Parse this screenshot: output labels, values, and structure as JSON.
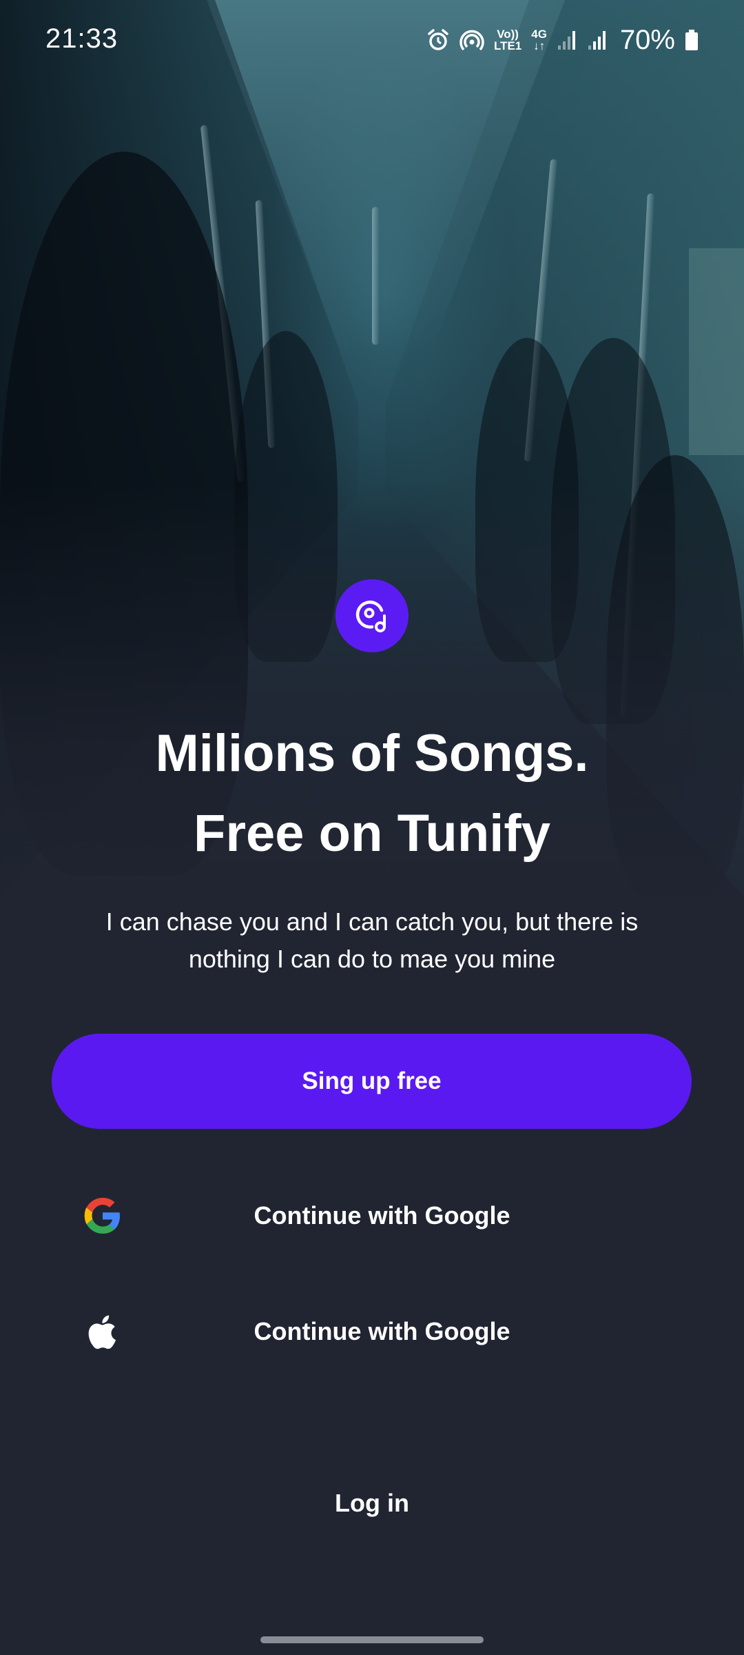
{
  "status_bar": {
    "time": "21:33",
    "volte_top": "Vo))",
    "volte_bottom": "LTE1",
    "network_type": "4G",
    "battery": "70%",
    "icons": [
      "alarm-icon",
      "hotspot-icon",
      "volte-icon",
      "data-arrows-icon",
      "signal-icon",
      "signal-icon",
      "battery-icon"
    ]
  },
  "hero": {
    "logo_icon": "music-disc-icon",
    "headline_line1": "Milions of Songs.",
    "headline_line2": "Free on Tunify",
    "subtitle": "I can chase you and I can catch you, but there is nothing I can do to mae you mine"
  },
  "actions": {
    "signup_label": "Sing up free",
    "google_label": "Continue with Google",
    "apple_label": "Continue with Google",
    "login_label": "Log in"
  },
  "colors": {
    "accent": "#5B19F2",
    "background": "#212532",
    "text": "#FFFFFF"
  }
}
